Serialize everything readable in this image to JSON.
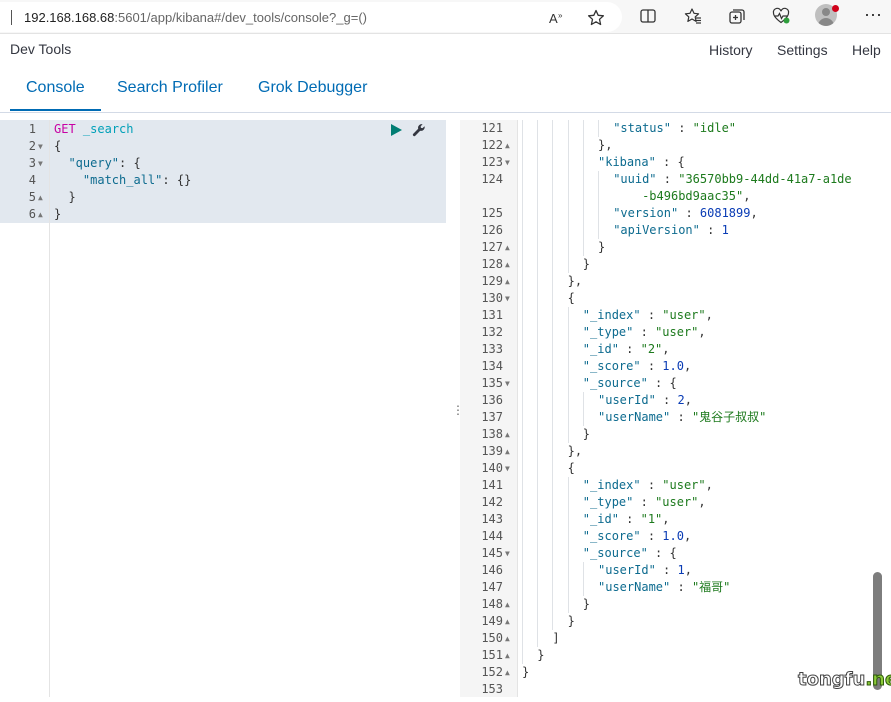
{
  "browser": {
    "url_host": "192.168.168.68",
    "url_rest": ":5601/app/kibana#/dev_tools/console?_g=()"
  },
  "app": {
    "title": "Dev Tools",
    "links": [
      "History",
      "Settings",
      "Help"
    ]
  },
  "tabs": [
    "Console",
    "Search Profiler",
    "Grok Debugger"
  ],
  "active_tab": "Console",
  "request": {
    "lines": [
      {
        "n": "1",
        "fold": "",
        "tokens": [
          [
            "m",
            "GET"
          ],
          [
            "p",
            " "
          ],
          [
            "u",
            "_search"
          ]
        ]
      },
      {
        "n": "2",
        "fold": "down",
        "tokens": [
          [
            "p",
            "{"
          ]
        ]
      },
      {
        "n": "3",
        "fold": "down",
        "tokens": [
          [
            "p",
            "  "
          ],
          [
            "k",
            "\"query\""
          ],
          [
            "p",
            ": {"
          ]
        ]
      },
      {
        "n": "4",
        "fold": "",
        "tokens": [
          [
            "p",
            "    "
          ],
          [
            "k",
            "\"match_all\""
          ],
          [
            "p",
            ": {}"
          ]
        ]
      },
      {
        "n": "5",
        "fold": "up",
        "tokens": [
          [
            "p",
            "  }"
          ]
        ]
      },
      {
        "n": "6",
        "fold": "up",
        "tokens": [
          [
            "p",
            "}"
          ]
        ]
      }
    ]
  },
  "response": {
    "lines": [
      {
        "n": "121",
        "fold": "",
        "indent": 6,
        "tokens": [
          [
            "k",
            "\"status\""
          ],
          [
            "p",
            " : "
          ],
          [
            "s",
            "\"idle\""
          ]
        ]
      },
      {
        "n": "122",
        "fold": "up",
        "indent": 5,
        "tokens": [
          [
            "p",
            "},"
          ]
        ]
      },
      {
        "n": "123",
        "fold": "down",
        "indent": 5,
        "tokens": [
          [
            "k",
            "\"kibana\""
          ],
          [
            "p",
            " : {"
          ]
        ]
      },
      {
        "n": "124",
        "fold": "",
        "indent": 6,
        "tokens": [
          [
            "k",
            "\"uuid\""
          ],
          [
            "p",
            " : "
          ],
          [
            "s",
            "\"36570bb9-44dd-41a7-a1de"
          ]
        ]
      },
      {
        "n": "",
        "fold": "",
        "indent": 6,
        "tokens": [
          [
            "s",
            "    -b496bd9aac35\""
          ],
          [
            "p",
            ","
          ]
        ]
      },
      {
        "n": "125",
        "fold": "",
        "indent": 6,
        "tokens": [
          [
            "k",
            "\"version\""
          ],
          [
            "p",
            " : "
          ],
          [
            "n",
            "6081899"
          ],
          [
            "p",
            ","
          ]
        ]
      },
      {
        "n": "126",
        "fold": "",
        "indent": 6,
        "tokens": [
          [
            "k",
            "\"apiVersion\""
          ],
          [
            "p",
            " : "
          ],
          [
            "n",
            "1"
          ]
        ]
      },
      {
        "n": "127",
        "fold": "up",
        "indent": 5,
        "tokens": [
          [
            "p",
            "}"
          ]
        ]
      },
      {
        "n": "128",
        "fold": "up",
        "indent": 4,
        "tokens": [
          [
            "p",
            "}"
          ]
        ]
      },
      {
        "n": "129",
        "fold": "up",
        "indent": 3,
        "tokens": [
          [
            "p",
            "},"
          ]
        ]
      },
      {
        "n": "130",
        "fold": "down",
        "indent": 3,
        "tokens": [
          [
            "p",
            "{"
          ]
        ]
      },
      {
        "n": "131",
        "fold": "",
        "indent": 4,
        "tokens": [
          [
            "k",
            "\"_index\""
          ],
          [
            "p",
            " : "
          ],
          [
            "s",
            "\"user\""
          ],
          [
            "p",
            ","
          ]
        ]
      },
      {
        "n": "132",
        "fold": "",
        "indent": 4,
        "tokens": [
          [
            "k",
            "\"_type\""
          ],
          [
            "p",
            " : "
          ],
          [
            "s",
            "\"user\""
          ],
          [
            "p",
            ","
          ]
        ]
      },
      {
        "n": "133",
        "fold": "",
        "indent": 4,
        "tokens": [
          [
            "k",
            "\"_id\""
          ],
          [
            "p",
            " : "
          ],
          [
            "s",
            "\"2\""
          ],
          [
            "p",
            ","
          ]
        ]
      },
      {
        "n": "134",
        "fold": "",
        "indent": 4,
        "tokens": [
          [
            "k",
            "\"_score\""
          ],
          [
            "p",
            " : "
          ],
          [
            "n",
            "1.0"
          ],
          [
            "p",
            ","
          ]
        ]
      },
      {
        "n": "135",
        "fold": "down",
        "indent": 4,
        "tokens": [
          [
            "k",
            "\"_source\""
          ],
          [
            "p",
            " : {"
          ]
        ]
      },
      {
        "n": "136",
        "fold": "",
        "indent": 5,
        "tokens": [
          [
            "k",
            "\"userId\""
          ],
          [
            "p",
            " : "
          ],
          [
            "n",
            "2"
          ],
          [
            "p",
            ","
          ]
        ]
      },
      {
        "n": "137",
        "fold": "",
        "indent": 5,
        "tokens": [
          [
            "k",
            "\"userName\""
          ],
          [
            "p",
            " : "
          ],
          [
            "s",
            "\"鬼谷子叔叔\""
          ]
        ]
      },
      {
        "n": "138",
        "fold": "up",
        "indent": 4,
        "tokens": [
          [
            "p",
            "}"
          ]
        ]
      },
      {
        "n": "139",
        "fold": "up",
        "indent": 3,
        "tokens": [
          [
            "p",
            "},"
          ]
        ]
      },
      {
        "n": "140",
        "fold": "down",
        "indent": 3,
        "tokens": [
          [
            "p",
            "{"
          ]
        ]
      },
      {
        "n": "141",
        "fold": "",
        "indent": 4,
        "tokens": [
          [
            "k",
            "\"_index\""
          ],
          [
            "p",
            " : "
          ],
          [
            "s",
            "\"user\""
          ],
          [
            "p",
            ","
          ]
        ]
      },
      {
        "n": "142",
        "fold": "",
        "indent": 4,
        "tokens": [
          [
            "k",
            "\"_type\""
          ],
          [
            "p",
            " : "
          ],
          [
            "s",
            "\"user\""
          ],
          [
            "p",
            ","
          ]
        ]
      },
      {
        "n": "143",
        "fold": "",
        "indent": 4,
        "tokens": [
          [
            "k",
            "\"_id\""
          ],
          [
            "p",
            " : "
          ],
          [
            "s",
            "\"1\""
          ],
          [
            "p",
            ","
          ]
        ]
      },
      {
        "n": "144",
        "fold": "",
        "indent": 4,
        "tokens": [
          [
            "k",
            "\"_score\""
          ],
          [
            "p",
            " : "
          ],
          [
            "n",
            "1.0"
          ],
          [
            "p",
            ","
          ]
        ]
      },
      {
        "n": "145",
        "fold": "down",
        "indent": 4,
        "tokens": [
          [
            "k",
            "\"_source\""
          ],
          [
            "p",
            " : {"
          ]
        ]
      },
      {
        "n": "146",
        "fold": "",
        "indent": 5,
        "tokens": [
          [
            "k",
            "\"userId\""
          ],
          [
            "p",
            " : "
          ],
          [
            "n",
            "1"
          ],
          [
            "p",
            ","
          ]
        ]
      },
      {
        "n": "147",
        "fold": "",
        "indent": 5,
        "tokens": [
          [
            "k",
            "\"userName\""
          ],
          [
            "p",
            " : "
          ],
          [
            "s",
            "\"福哥\""
          ]
        ]
      },
      {
        "n": "148",
        "fold": "up",
        "indent": 4,
        "tokens": [
          [
            "p",
            "}"
          ]
        ]
      },
      {
        "n": "149",
        "fold": "up",
        "indent": 3,
        "tokens": [
          [
            "p",
            "}"
          ]
        ]
      },
      {
        "n": "150",
        "fold": "up",
        "indent": 2,
        "tokens": [
          [
            "p",
            "]"
          ]
        ]
      },
      {
        "n": "151",
        "fold": "up",
        "indent": 1,
        "tokens": [
          [
            "p",
            "}"
          ]
        ]
      },
      {
        "n": "152",
        "fold": "up",
        "indent": 0,
        "tokens": [
          [
            "p",
            "}"
          ]
        ]
      },
      {
        "n": "153",
        "fold": "",
        "indent": 0,
        "tokens": []
      }
    ]
  },
  "watermark": {
    "main": "tongfu",
    "suffix": ".net"
  },
  "colors": {
    "accent": "#006bb4",
    "method": "#c800a4",
    "url": "#00a0b8",
    "key": "#0d6b8f",
    "string": "#1d7a1d",
    "number": "#0a3cb5",
    "play": "#017d73"
  },
  "icons": [
    "read-aloud-icon",
    "favorite-star-icon",
    "split-screen-icon",
    "favorites-icon",
    "collections-icon",
    "health-icon",
    "profile-avatar-icon",
    "send-request-icon",
    "wrench-icon"
  ]
}
